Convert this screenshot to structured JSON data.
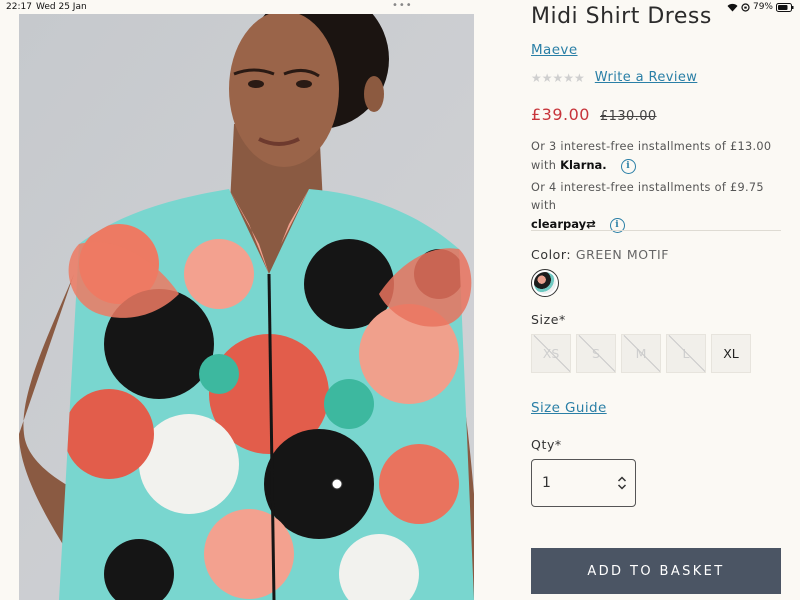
{
  "status_bar": {
    "time": "22:17",
    "date": "Wed 25 Jan",
    "dots": "•••",
    "battery": "79%"
  },
  "product": {
    "title": "Midi Shirt Dress",
    "brand": "Maeve",
    "rating_stars": "★★★★★",
    "rating_value": 0,
    "review_link": "Write a Review",
    "price": "£39.00",
    "was_price": "£130.00"
  },
  "payments": {
    "klarna_text": "Or 3 interest-free installments of £13.00 with",
    "klarna_logo": "Klarna.",
    "clearpay_text": "Or 4 interest-free installments of £9.75 with",
    "clearpay_logo": "clearpay⇄"
  },
  "color": {
    "label": "Color:",
    "value": "GREEN MOTIF"
  },
  "size": {
    "label": "Size*",
    "options": [
      {
        "label": "XS",
        "available": false
      },
      {
        "label": "S",
        "available": false
      },
      {
        "label": "M",
        "available": false
      },
      {
        "label": "L",
        "available": false
      },
      {
        "label": "XL",
        "available": true
      }
    ],
    "guide_link": "Size Guide"
  },
  "quantity": {
    "label": "Qty*",
    "value": "1"
  },
  "cta": {
    "add_to_basket": "ADD TO BASKET"
  },
  "colors": {
    "background": "#fbf9f4",
    "link": "#2a7fa6",
    "sale_price": "#c7343a",
    "button": "#4b5564"
  },
  "icons": {
    "info": "info-circle-icon",
    "qty": "chevron-up-down-icon",
    "wifi": "wifi-icon",
    "battery": "battery-icon"
  }
}
